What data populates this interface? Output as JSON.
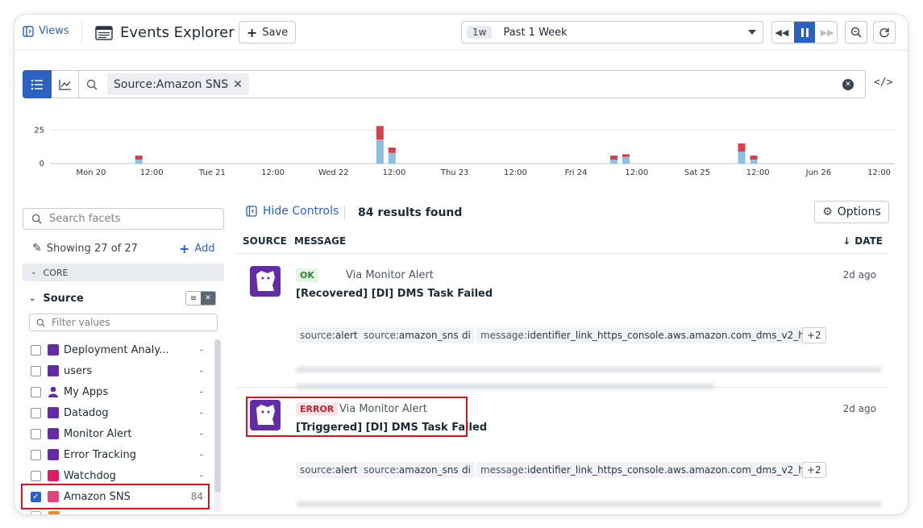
{
  "topbar": {
    "views_label": "Views",
    "title": "Events Explorer",
    "save_label": "Save",
    "time_badge": "1w",
    "time_range": "Past 1 Week"
  },
  "search": {
    "query_chip": "Source:Amazon SNS"
  },
  "chart": {
    "y_ticks": [
      "25",
      "0"
    ],
    "x_ticks": [
      "Mon 20",
      "12:00",
      "Tue 21",
      "12:00",
      "Wed 22",
      "12:00",
      "Thu 23",
      "12:00",
      "Fri 24",
      "12:00",
      "Sat 25",
      "12:00",
      "Jun 26",
      "12:00"
    ],
    "colors": {
      "ok": "#8cbfe0",
      "error": "#d9404a"
    }
  },
  "chart_data": {
    "type": "bar",
    "stacked": true,
    "ylim": [
      0,
      30
    ],
    "y_ticks": [
      0,
      25
    ],
    "series": [
      {
        "name": "",
        "color": "#8cbfe0",
        "points": [
          [
            0.73,
            3
          ],
          [
            2.73,
            18
          ],
          [
            2.83,
            8
          ],
          [
            4.67,
            3
          ],
          [
            4.77,
            5
          ],
          [
            5.73,
            9
          ],
          [
            5.83,
            3
          ]
        ]
      },
      {
        "name": "",
        "color": "#d9404a",
        "points": [
          [
            0.73,
            3
          ],
          [
            2.73,
            10
          ],
          [
            2.83,
            4
          ],
          [
            4.67,
            3
          ],
          [
            4.77,
            2
          ],
          [
            5.73,
            6
          ],
          [
            5.83,
            3
          ]
        ]
      }
    ]
  },
  "facets": {
    "search_placeholder": "Search facets",
    "showing": "Showing 27 of 27",
    "add_label": "Add",
    "group_label": "CORE",
    "source_title": "Source",
    "filter_placeholder": "Filter values",
    "items": [
      {
        "label": "Deployment Analy...",
        "count": "-"
      },
      {
        "label": "users",
        "count": "-"
      },
      {
        "label": "My Apps",
        "count": "-"
      },
      {
        "label": "Datadog",
        "count": "-"
      },
      {
        "label": "Monitor Alert",
        "count": "-"
      },
      {
        "label": "Error Tracking",
        "count": "-"
      },
      {
        "label": "Watchdog",
        "count": "-"
      },
      {
        "label": "Amazon SNS",
        "count": "84"
      }
    ]
  },
  "results": {
    "hide_controls": "Hide Controls",
    "count_label": "84 results found",
    "options_label": "Options",
    "col_source": "SOURCE",
    "col_message": "MESSAGE",
    "col_date": "DATE",
    "events": [
      {
        "status": "OK",
        "via": "Via Monitor Alert",
        "title": "[Recovered] [DI] DMS Task Failed",
        "date": "2d ago",
        "tags": [
          {
            "k": "source",
            "v": "alert"
          },
          {
            "k": "source",
            "v": "amazon_sns"
          },
          {
            "k": "",
            "v": "di"
          },
          {
            "k": "message",
            "v": "identifier_link_https_console.aws.amazon.com_dms_v2_ho..."
          }
        ],
        "more": "+2"
      },
      {
        "status": "ERROR",
        "via": "Via Monitor Alert",
        "title": "[Triggered] [DI] DMS Task Failed",
        "date": "2d ago",
        "tags": [
          {
            "k": "source",
            "v": "alert"
          },
          {
            "k": "source",
            "v": "amazon_sns"
          },
          {
            "k": "",
            "v": "di"
          },
          {
            "k": "message",
            "v": "identifier_link_https_console.aws.amazon.com_dms_v2_ho..."
          }
        ],
        "more": "+2"
      }
    ]
  }
}
